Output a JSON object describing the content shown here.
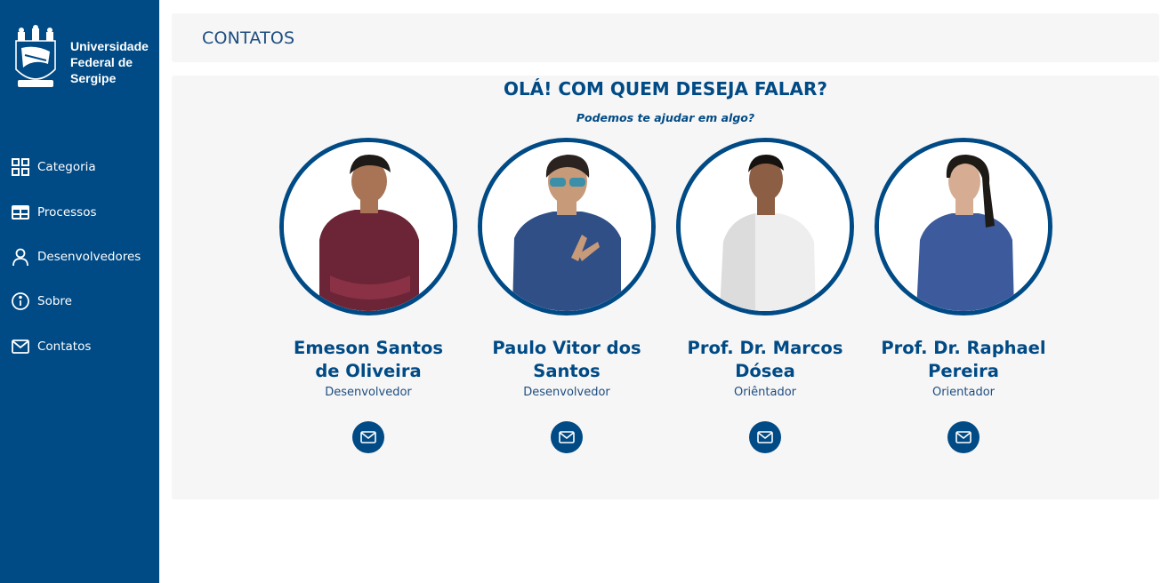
{
  "brand": {
    "name_line1": "Universidade",
    "name_line2": "Federal de",
    "name_line3": "Sergipe",
    "emblem_icon": "university-crest-icon"
  },
  "sidebar": {
    "items": [
      {
        "label": "Categoria",
        "icon": "grid-icon"
      },
      {
        "label": "Processos",
        "icon": "table-icon"
      },
      {
        "label": "Desenvolvedores",
        "icon": "user-icon"
      },
      {
        "label": "Sobre",
        "icon": "info-icon"
      },
      {
        "label": "Contatos",
        "icon": "mail-icon"
      }
    ]
  },
  "header": {
    "title": "CONTATOS"
  },
  "main": {
    "greeting": "OLÁ! COM QUEM DESEJA FALAR?",
    "subgreeting": "Podemos te ajudar em algo?",
    "contacts": [
      {
        "name_line1": "Emeson Santos",
        "name_line2": "de Oliveira",
        "role": "Desenvolvedor",
        "shirt_color": "#6b2536"
      },
      {
        "name_line1": "Paulo Vitor dos",
        "name_line2": "Santos",
        "role": "Desenvolvedor",
        "shirt_color": "#2f4f86"
      },
      {
        "name_line1": "Prof. Dr. Marcos",
        "name_line2": "Dósea",
        "role": "Oriêntador",
        "shirt_color": "#eeeeee"
      },
      {
        "name_line1": "Prof. Dr. Raphael",
        "name_line2": "Pereira",
        "role": "Orientador",
        "shirt_color": "#3d5a9c"
      }
    ]
  },
  "colors": {
    "primary": "#004a85",
    "card_bg": "#f6f6f6",
    "header_text": "#1d4d80"
  }
}
